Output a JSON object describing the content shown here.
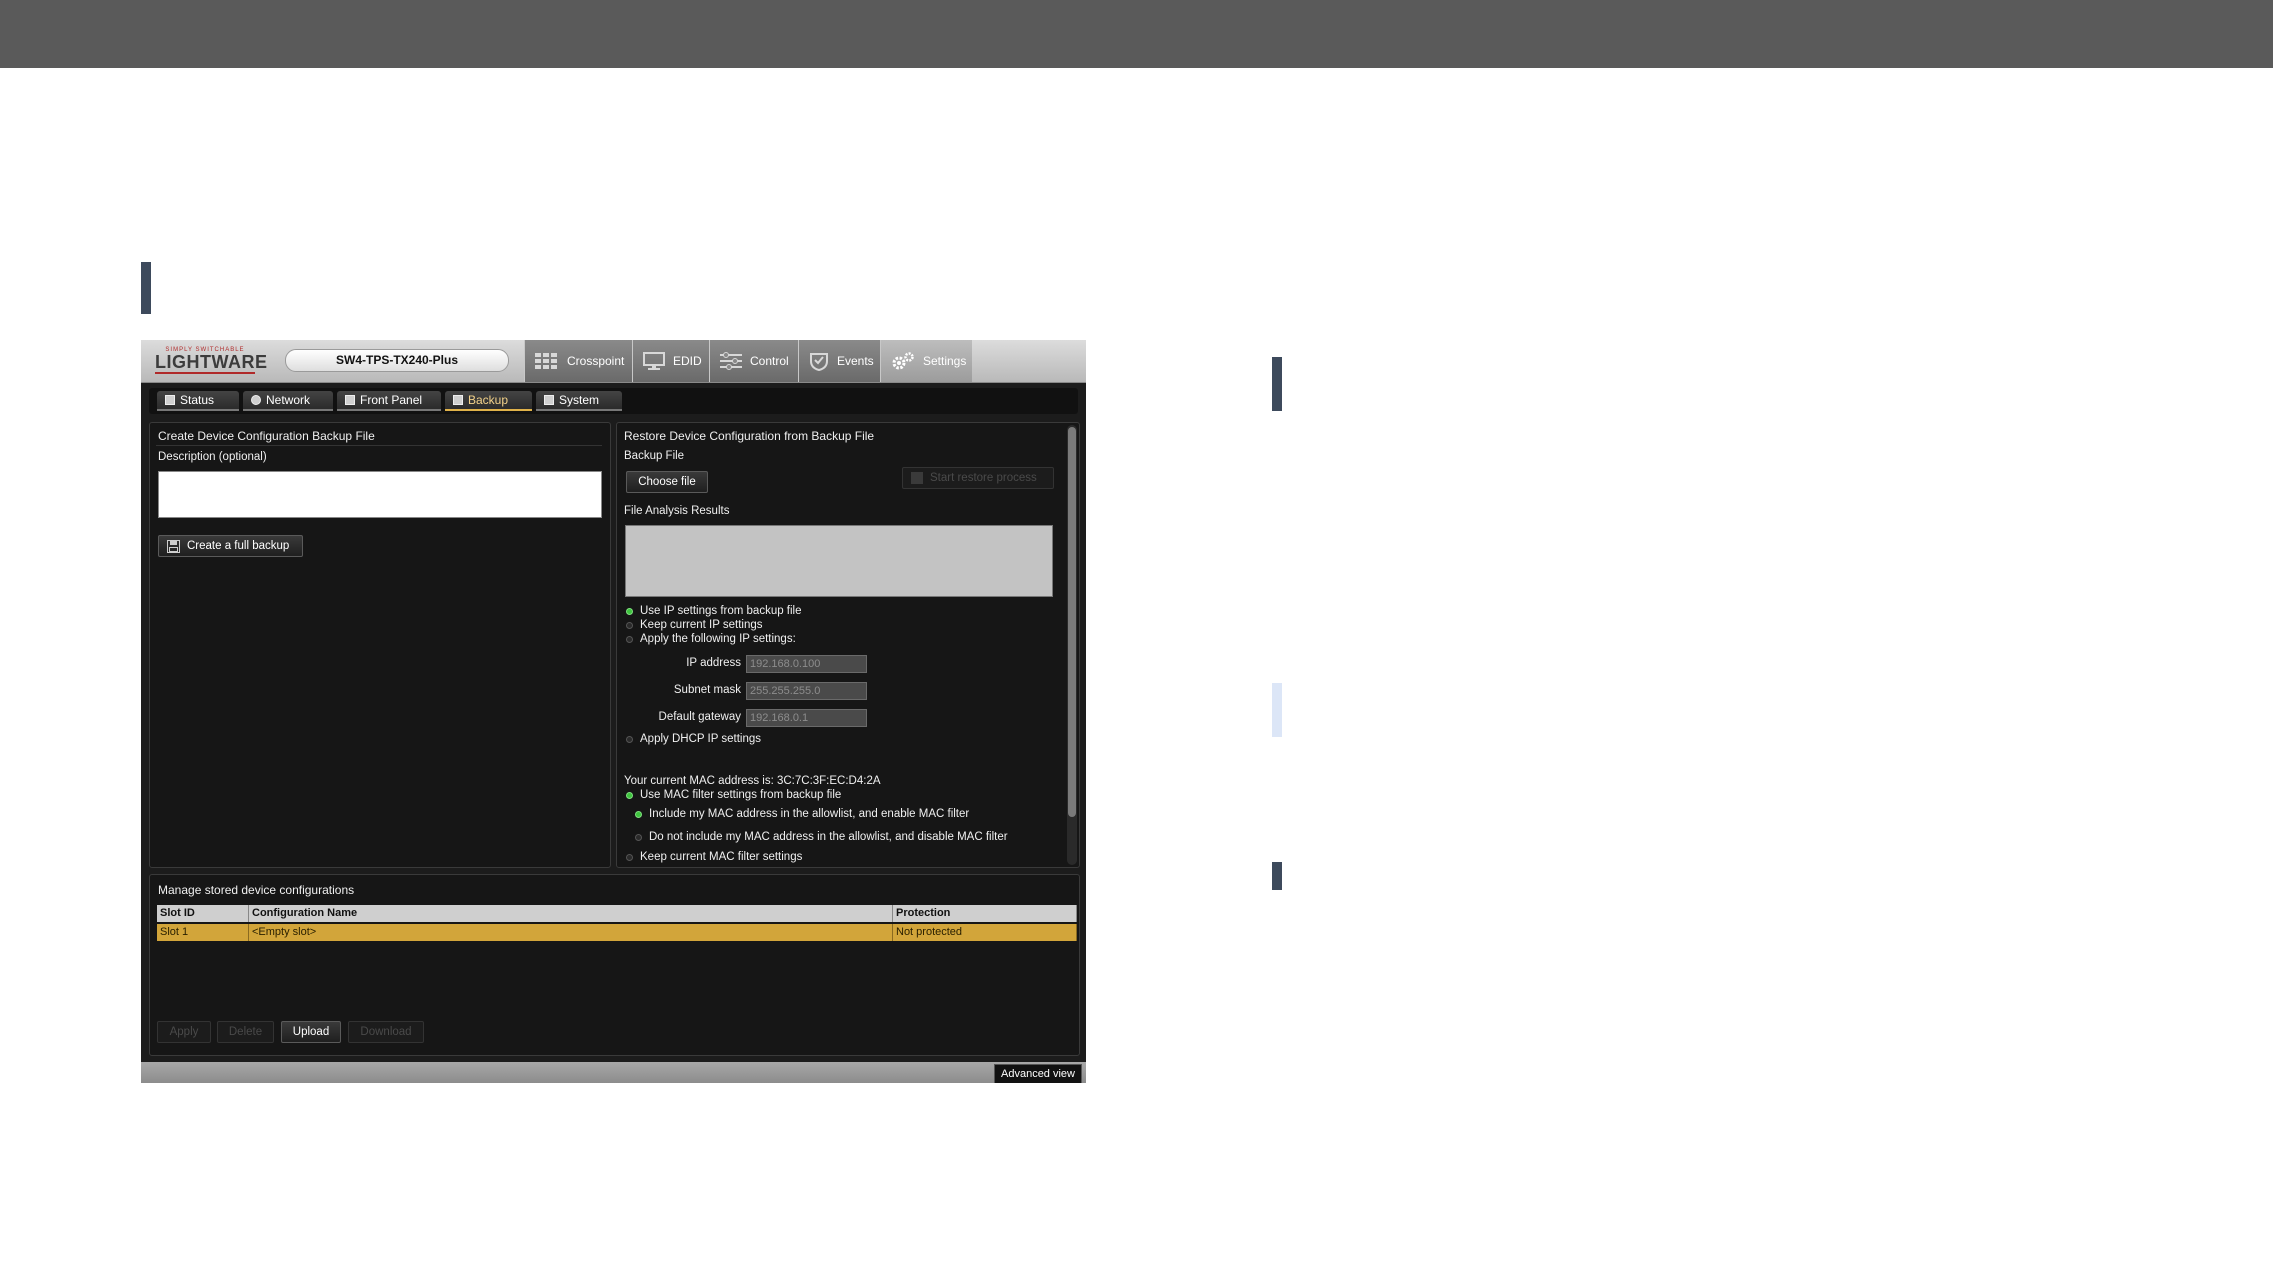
{
  "app": {
    "logo": {
      "tagline": "SIMPLY SWITCHABLE",
      "name": "LIGHTWARE"
    },
    "device_name": "SW4-TPS-TX240-Plus",
    "main_tabs": [
      {
        "label": "Crosspoint",
        "icon": "crosspoint-grid-icon"
      },
      {
        "label": "EDID",
        "icon": "monitor-icon"
      },
      {
        "label": "Control",
        "icon": "sliders-icon"
      },
      {
        "label": "Events",
        "icon": "events-icon"
      },
      {
        "label": "Settings",
        "icon": "gears-icon",
        "active": true
      }
    ],
    "sub_tabs": [
      {
        "label": "Status"
      },
      {
        "label": "Network"
      },
      {
        "label": "Front Panel"
      },
      {
        "label": "Backup",
        "active": true
      },
      {
        "label": "System"
      }
    ],
    "create_panel": {
      "title": "Create Device Configuration Backup File",
      "description_label": "Description (optional)",
      "description_value": "",
      "create_button": "Create a full backup"
    },
    "restore_panel": {
      "title": "Restore Device Configuration from Backup File",
      "backup_file_label": "Backup File",
      "choose_file_button": "Choose file",
      "start_restore_button": "Start restore process",
      "analysis_label": "File Analysis Results",
      "ip_options": [
        {
          "label": "Use IP settings from backup file",
          "selected": true
        },
        {
          "label": "Keep current IP settings",
          "selected": false
        },
        {
          "label": "Apply the following IP settings:",
          "selected": false
        }
      ],
      "ip_fields": [
        {
          "label": "IP address",
          "value": "192.168.0.100"
        },
        {
          "label": "Subnet mask",
          "value": "255.255.255.0"
        },
        {
          "label": "Default gateway",
          "value": "192.168.0.1"
        }
      ],
      "dhcp_option": "Apply DHCP IP settings",
      "mac_text": "Your current MAC address is: 3C:7C:3F:EC:D4:2A",
      "mac_options": [
        {
          "label": "Use MAC filter settings from backup file",
          "selected": true
        },
        {
          "label": "Include my MAC address in the allowlist, and enable MAC filter",
          "selected": true
        },
        {
          "label": "Do not include my MAC address in the allowlist, and disable MAC filter",
          "selected": false
        },
        {
          "label": "Keep current MAC filter settings",
          "selected": false
        }
      ]
    },
    "manage_panel": {
      "title": "Manage stored device configurations",
      "columns": [
        "Slot ID",
        "Configuration Name",
        "Protection"
      ],
      "rows": [
        {
          "slot": "Slot 1",
          "name": "<Empty slot>",
          "protection": "Not protected"
        }
      ],
      "buttons": [
        {
          "label": "Apply",
          "enabled": false
        },
        {
          "label": "Delete",
          "enabled": false
        },
        {
          "label": "Upload",
          "enabled": true
        },
        {
          "label": "Download",
          "enabled": false
        }
      ]
    },
    "advanced_view": "Advanced view"
  },
  "colors": {
    "top_bar": "#5a5a5a",
    "accent_dark": "#3d4a5c",
    "accent_light": "#dce6f7",
    "selected_row": "#d2a53a",
    "radio_on": "#3ec43e"
  }
}
